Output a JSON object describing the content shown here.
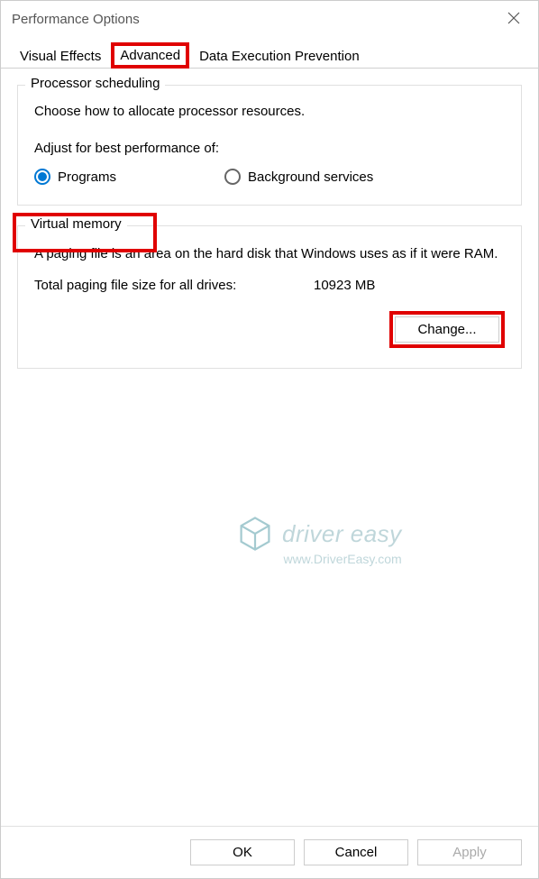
{
  "window": {
    "title": "Performance Options"
  },
  "tabs": {
    "visual": "Visual Effects",
    "advanced": "Advanced",
    "dep": "Data Execution Prevention"
  },
  "processor": {
    "title": "Processor scheduling",
    "desc": "Choose how to allocate processor resources.",
    "adjust": "Adjust for best performance of:",
    "programs": "Programs",
    "bg": "Background services"
  },
  "vm": {
    "title": "Virtual memory",
    "desc": "A paging file is an area on the hard disk that Windows uses as if it were RAM.",
    "pf_label": "Total paging file size for all drives:",
    "pf_value": "10923 MB",
    "change": "Change..."
  },
  "buttons": {
    "ok": "OK",
    "cancel": "Cancel",
    "apply": "Apply"
  },
  "watermark": {
    "line1": "driver easy",
    "line2": "www.DriverEasy.com"
  }
}
